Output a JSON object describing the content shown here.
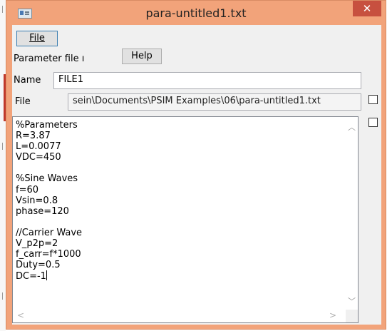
{
  "window": {
    "title": "para-untitled1.txt",
    "close_label": "✕"
  },
  "menu": {
    "file_label": "File"
  },
  "param_row": {
    "label": "Parameter file ı",
    "help_label": "Help"
  },
  "name_row": {
    "label": "Name",
    "value": "FILE1"
  },
  "file_row": {
    "label": "File",
    "value": "sein\\Documents\\PSIM Examples\\06\\para-untitled1.txt"
  },
  "editor": {
    "lines": "%Parameters\nR=3.87\nL=0.0077\nVDC=450\n\n%Sine Waves\nf=60\nVsin=0.8\nphase=120\n\n//Carrier Wave\nV_p2p=2\nf_carr=f*1000\nDuty=0.5\nDC=-1"
  },
  "scroll_icons": {
    "up": "chevron-up-icon",
    "down": "chevron-down-icon",
    "left": "chevron-left-icon",
    "right": "chevron-right-icon"
  },
  "colors": {
    "title_bar": "#f2a37a",
    "close_button": "#c7503f",
    "client_bg": "#f0f0f0"
  }
}
